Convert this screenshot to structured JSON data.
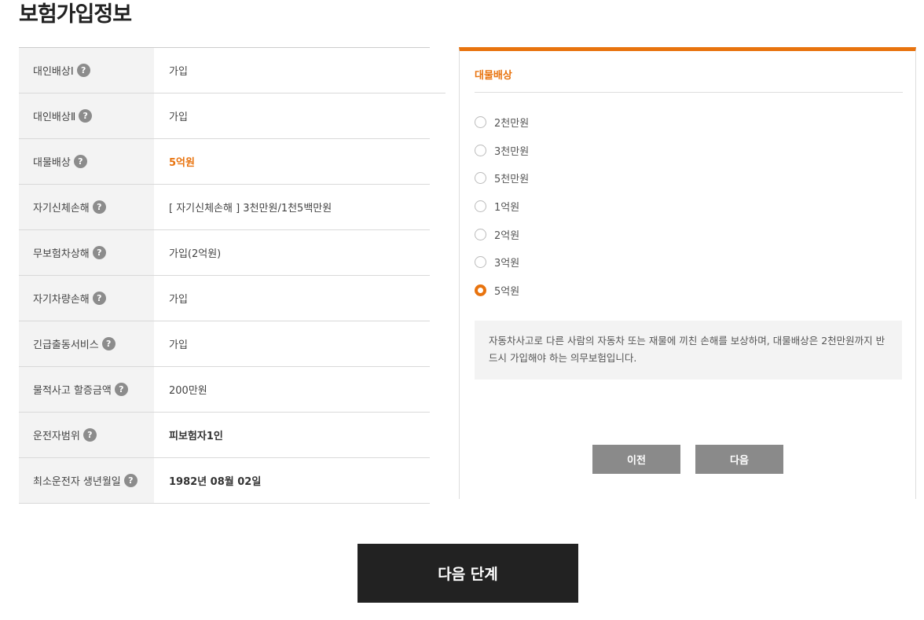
{
  "page": {
    "title": "보험가입정보"
  },
  "help_glyph": "?",
  "table": {
    "rows": [
      {
        "label": "대인배상Ⅰ",
        "value": "가입"
      },
      {
        "label": "대인배상Ⅱ",
        "value": "가입"
      },
      {
        "label": "대물배상",
        "value": "5억원"
      },
      {
        "label": "자기신체손해",
        "value": "[ 자기신체손해 ]  3천만원/1천5백만원"
      },
      {
        "label": "무보험차상해",
        "value": "가입(2억원)"
      },
      {
        "label": "자기차량손해",
        "value": "가입"
      },
      {
        "label": "긴급출동서비스",
        "value": "가입"
      },
      {
        "label": "물적사고 할증금액",
        "value": "200만원"
      },
      {
        "label": "운전자범위",
        "value": "피보험자1인"
      },
      {
        "label": "최소운전자 생년월일",
        "value": "1982년 08월 02일"
      }
    ]
  },
  "panel": {
    "title": "대물배상",
    "options": [
      "2천만원",
      "3천만원",
      "5천만원",
      "1억원",
      "2억원",
      "3억원",
      "5억원"
    ],
    "selected": "5억원",
    "description": "자동차사고로 다른 사람의 자동차 또는 재물에 끼친 손해를 보상하며, 대물배상은 2천만원까지 반드시 가입해야 하는 의무보험입니다.",
    "prev_label": "이전",
    "next_label": "다음"
  },
  "next_step_label": "다음 단계",
  "colors": {
    "accent": "#e8730e",
    "dark_button": "#222222",
    "gray_button": "#8a8a8a"
  }
}
